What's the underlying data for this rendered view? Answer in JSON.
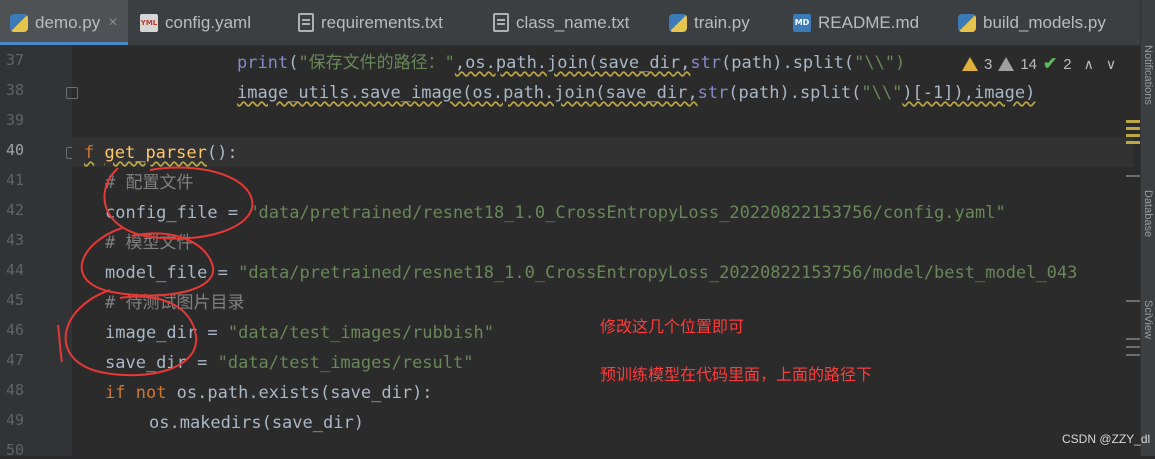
{
  "tabs": [
    {
      "label": "demo.py",
      "icon": "python-file-icon",
      "active": true,
      "close": "×"
    },
    {
      "label": "config.yaml",
      "icon": "yaml-file-icon",
      "icon_text": "YML"
    },
    {
      "label": "requirements.txt",
      "icon": "text-file-icon"
    },
    {
      "label": "class_name.txt",
      "icon": "text-file-icon"
    },
    {
      "label": "train.py",
      "icon": "python-file-icon"
    },
    {
      "label": "README.md",
      "icon": "markdown-file-icon",
      "icon_text": "MD"
    },
    {
      "label": "build_models.py",
      "icon": "python-file-icon"
    }
  ],
  "line_numbers": [
    "37",
    "38",
    "39",
    "40",
    "41",
    "42",
    "43",
    "44",
    "45",
    "46",
    "47",
    "48",
    "49",
    "50"
  ],
  "code": {
    "l37": {
      "print": "print",
      "open": "(",
      "str": "\"保存文件的路径：\"",
      "rest1": ",os.path.join(save_dir,",
      "strfn": "str",
      "rest2": "(path).split(",
      "esc": "\"\\\\\")"
    },
    "l38": {
      "a": "image_utils.save_image(os.path.join(save_dir,",
      "strfn": "str",
      "b": "(path).split(",
      "esc": "\"\\\\\"",
      "c": ")[-1]),image)"
    },
    "l40": {
      "kw": "f",
      "fn": "get_parser",
      "rest": "():"
    },
    "l41": {
      "comment": "# 配置文件"
    },
    "l42": {
      "name": "config_file",
      "eq": " = ",
      "value": "\"data/pretrained/resnet18_1.0_CrossEntropyLoss_20220822153756/config.yaml\""
    },
    "l43": {
      "comment": "# 模型文件"
    },
    "l44": {
      "name": "model_file",
      "eq": " = ",
      "value": "\"data/pretrained/resnet18_1.0_CrossEntropyLoss_20220822153756/model/best_model_043"
    },
    "l45": {
      "comment": "# 待测试图片目录"
    },
    "l46": {
      "name": "image_dir",
      "eq": " = ",
      "value": "\"data/test_images/rubbish\""
    },
    "l47": {
      "name": "save_dir",
      "eq": " = ",
      "value": "\"data/test_images/result\""
    },
    "l48": {
      "if": "if",
      "not": " not",
      "rest": " os.path.exists(save_dir):"
    },
    "l49": {
      "code": "os.makedirs(save_dir)"
    }
  },
  "indicators": {
    "warnings": "3",
    "weak_warnings": "14",
    "ok": "2",
    "up": "∧",
    "down": "∨"
  },
  "annotations": {
    "note1": "修改这几个位置即可",
    "note2": "预训练模型在代码里面，上面的路径下"
  },
  "watermark": "CSDN @ZZY_dl",
  "side_labels": [
    "Notifications",
    "Database",
    "SciView"
  ],
  "colors": {
    "keyword": "#cc7832",
    "function": "#ffc66d",
    "string": "#6a8759",
    "comment": "#808080",
    "annotation": "#ff3b3b"
  }
}
